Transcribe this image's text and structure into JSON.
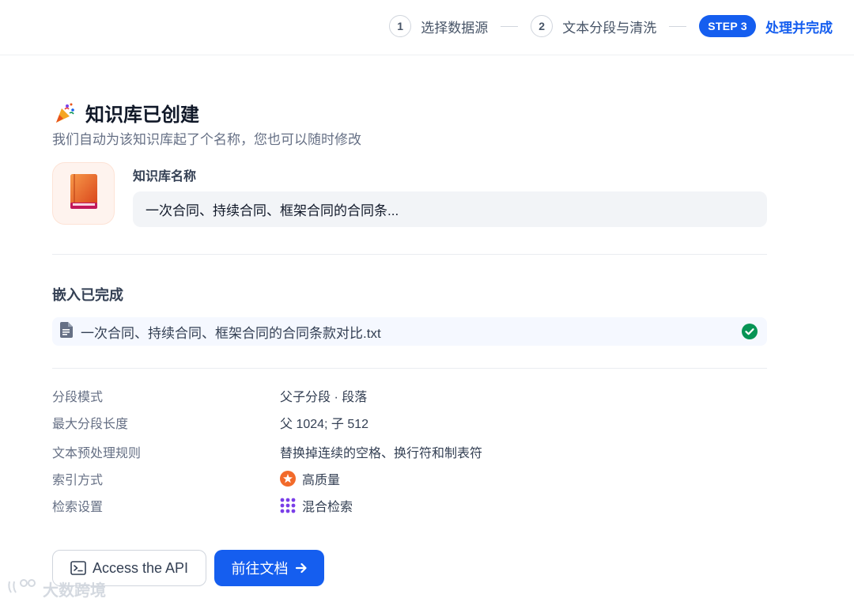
{
  "stepper": {
    "steps": [
      {
        "num": "1",
        "label": "选择数据源"
      },
      {
        "num": "2",
        "label": "文本分段与清洗"
      },
      {
        "badge": "STEP 3",
        "label": "处理并完成"
      }
    ]
  },
  "main": {
    "title": "知识库已创建",
    "title_icon": "party-popper-icon",
    "subtitle": "我们自动为该知识库起了个名称，您也可以随时修改",
    "kb_name_label": "知识库名称",
    "kb_name_value": "一次合同、持续合同、框架合同的合同条...",
    "kb_icon": "book-icon"
  },
  "embedding": {
    "title": "嵌入已完成",
    "file_name": "一次合同、持续合同、框架合同的合同条款对比.txt",
    "status_icon": "check-circle-icon"
  },
  "settings": [
    {
      "label": "分段模式",
      "value": "父子分段 · 段落"
    },
    {
      "label": "最大分段长度",
      "value": "父 1024; 子 512"
    },
    {
      "label": "文本预处理规则",
      "value": "替换掉连续的空格、换行符和制表符"
    },
    {
      "label": "索引方式",
      "value": "高质量",
      "icon": "high-quality-icon"
    },
    {
      "label": "检索设置",
      "value": "混合检索",
      "icon": "hybrid-search-icon"
    }
  ],
  "actions": {
    "api_label": "Access the API",
    "docs_label": "前往文档"
  },
  "watermark": "大数跨境",
  "colors": {
    "accent": "#155eef",
    "success": "#079455",
    "kb_icon": "#e8541c",
    "quality": "#f26a2a",
    "hybrid": "#7a3ee8"
  }
}
